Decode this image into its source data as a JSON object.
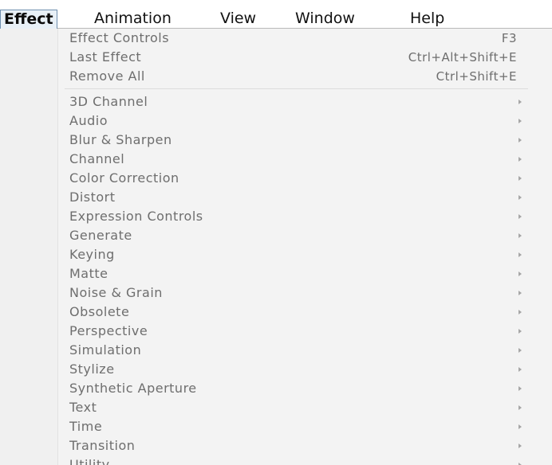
{
  "menubar": {
    "items": [
      {
        "label": "Effect"
      },
      {
        "label": "Animation"
      },
      {
        "label": "View"
      },
      {
        "label": "Window"
      },
      {
        "label": "Help"
      }
    ]
  },
  "effect_menu": {
    "top_items": [
      {
        "label": "Effect Controls",
        "shortcut": "F3"
      },
      {
        "label": "Last Effect",
        "shortcut": "Ctrl+Alt+Shift+E"
      },
      {
        "label": "Remove All",
        "shortcut": "Ctrl+Shift+E"
      }
    ],
    "categories": [
      {
        "label": "3D Channel"
      },
      {
        "label": "Audio"
      },
      {
        "label": "Blur & Sharpen"
      },
      {
        "label": "Channel"
      },
      {
        "label": "Color Correction"
      },
      {
        "label": "Distort"
      },
      {
        "label": "Expression Controls"
      },
      {
        "label": "Generate"
      },
      {
        "label": "Keying"
      },
      {
        "label": "Matte"
      },
      {
        "label": "Noise & Grain"
      },
      {
        "label": "Obsolete"
      },
      {
        "label": "Perspective"
      },
      {
        "label": "Simulation"
      },
      {
        "label": "Stylize"
      },
      {
        "label": "Synthetic Aperture"
      },
      {
        "label": "Text"
      },
      {
        "label": "Time"
      },
      {
        "label": "Transition"
      },
      {
        "label": "Utility"
      }
    ]
  },
  "colors": {
    "menu_background": "#f3f3f3",
    "menu_text": "#6e6e6e",
    "active_menu_highlight": "#e8f0f7",
    "active_menu_border": "#6f8faf"
  },
  "icons": {
    "submenu": "submenu-arrow-icon"
  }
}
